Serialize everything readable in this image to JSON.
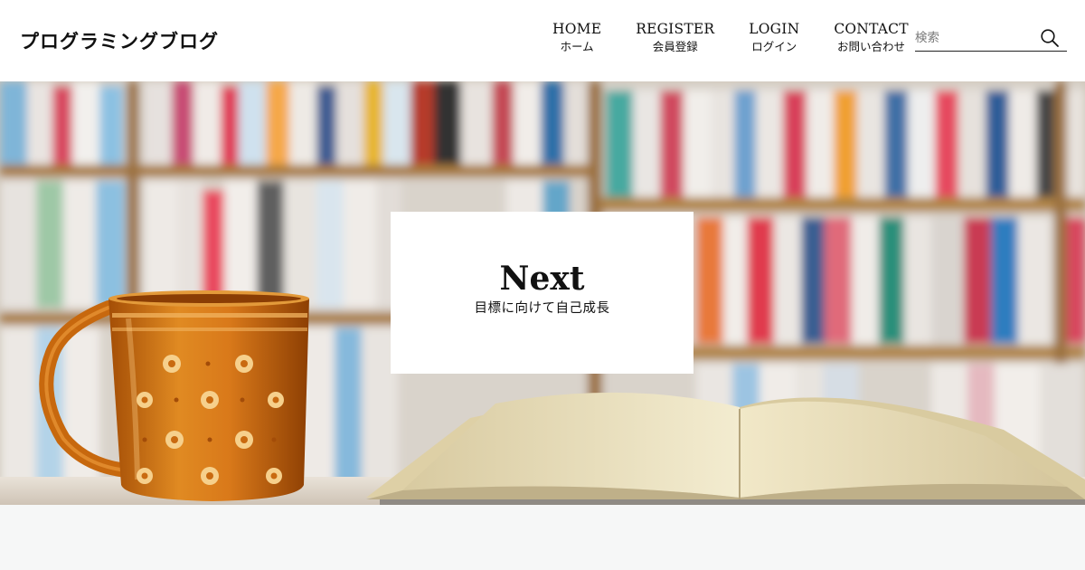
{
  "site": {
    "logo": "プログラミングブログ"
  },
  "nav": {
    "items": [
      {
        "en": "HOME",
        "ja": "ホーム"
      },
      {
        "en": "REGISTER",
        "ja": "会員登録"
      },
      {
        "en": "LOGIN",
        "ja": "ログイン"
      },
      {
        "en": "CONTACT",
        "ja": "お問い合わせ"
      }
    ]
  },
  "search": {
    "placeholder": "検索",
    "value": "",
    "icon": "search-icon"
  },
  "hero": {
    "title": "Next",
    "subtitle": "目標に向けて自己成長",
    "image": "coffee-mug-and-open-book-in-library-photo"
  },
  "colors": {
    "header_bg": "#ffffff",
    "page_bg": "#f6f7f7",
    "text": "#111111",
    "mug": "#c96a10"
  }
}
